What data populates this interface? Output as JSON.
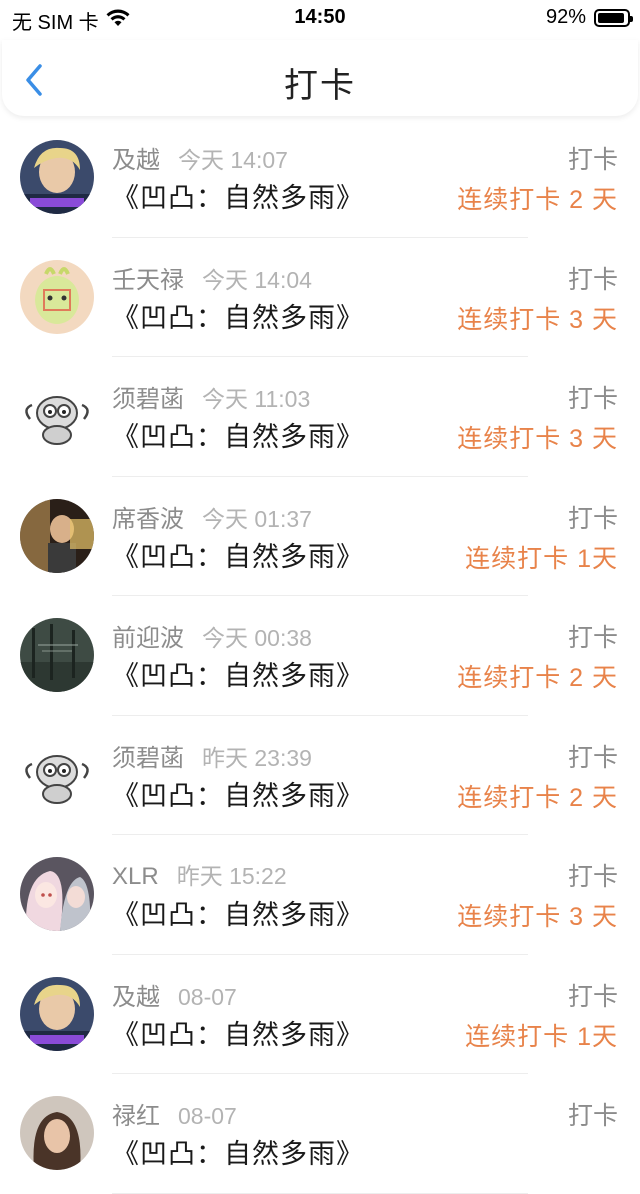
{
  "status_bar": {
    "carrier": "无 SIM 卡",
    "time": "14:50",
    "battery": "92%",
    "battery_level": 0.92
  },
  "nav": {
    "title": "打卡",
    "back_icon": "chevron-left-icon"
  },
  "checkins": [
    {
      "name": "及越",
      "time": "今天 14:07",
      "book": "《凹凸：自然多雨》",
      "action": "打卡",
      "streak": "连续打卡 2 天",
      "avatar": "blond-portrait"
    },
    {
      "name": "壬天禄",
      "time": "今天 14:04",
      "book": "《凹凸：自然多雨》",
      "action": "打卡",
      "streak": "连续打卡 3 天",
      "avatar": "cartoon-character"
    },
    {
      "name": "须碧菡",
      "time": "今天 11:03",
      "book": "《凹凸：自然多雨》",
      "action": "打卡",
      "streak": "连续打卡 3 天",
      "avatar": "sketch-creature"
    },
    {
      "name": "席香波",
      "time": "今天 01:37",
      "book": "《凹凸：自然多雨》",
      "action": "打卡",
      "streak": "连续打卡 1天",
      "avatar": "dark-photo"
    },
    {
      "name": "前迎波",
      "time": "今天 00:38",
      "book": "《凹凸：自然多雨》",
      "action": "打卡",
      "streak": "连续打卡 2 天",
      "avatar": "forest"
    },
    {
      "name": "须碧菡",
      "time": "昨天 23:39",
      "book": "《凹凸：自然多雨》",
      "action": "打卡",
      "streak": "连续打卡 2 天",
      "avatar": "sketch-creature"
    },
    {
      "name": "XLR",
      "time": "昨天 15:22",
      "book": "《凹凸：自然多雨》",
      "action": "打卡",
      "streak": "连续打卡 3 天",
      "avatar": "anime-girls"
    },
    {
      "name": "及越",
      "time": "08-07",
      "book": "《凹凸：自然多雨》",
      "action": "打卡",
      "streak": "连续打卡 1天",
      "avatar": "blond-portrait"
    },
    {
      "name": "禄红",
      "time": "08-07",
      "book": "《凹凸：自然多雨》",
      "action": "打卡",
      "streak": "",
      "avatar": "woman-portrait"
    }
  ],
  "colors": {
    "accent": "#e8834a",
    "back": "#3a8ee6",
    "muted": "#8c8c8c"
  }
}
